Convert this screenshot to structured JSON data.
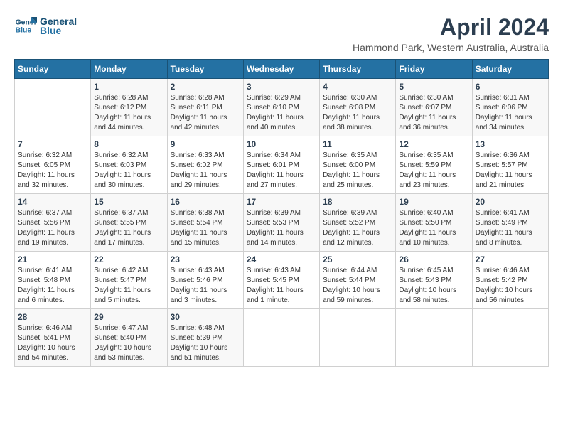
{
  "header": {
    "logo_line1": "General",
    "logo_line2": "Blue",
    "month_title": "April 2024",
    "subtitle": "Hammond Park, Western Australia, Australia"
  },
  "weekdays": [
    "Sunday",
    "Monday",
    "Tuesday",
    "Wednesday",
    "Thursday",
    "Friday",
    "Saturday"
  ],
  "weeks": [
    [
      {
        "day": "",
        "info": ""
      },
      {
        "day": "1",
        "info": "Sunrise: 6:28 AM\nSunset: 6:12 PM\nDaylight: 11 hours\nand 44 minutes."
      },
      {
        "day": "2",
        "info": "Sunrise: 6:28 AM\nSunset: 6:11 PM\nDaylight: 11 hours\nand 42 minutes."
      },
      {
        "day": "3",
        "info": "Sunrise: 6:29 AM\nSunset: 6:10 PM\nDaylight: 11 hours\nand 40 minutes."
      },
      {
        "day": "4",
        "info": "Sunrise: 6:30 AM\nSunset: 6:08 PM\nDaylight: 11 hours\nand 38 minutes."
      },
      {
        "day": "5",
        "info": "Sunrise: 6:30 AM\nSunset: 6:07 PM\nDaylight: 11 hours\nand 36 minutes."
      },
      {
        "day": "6",
        "info": "Sunrise: 6:31 AM\nSunset: 6:06 PM\nDaylight: 11 hours\nand 34 minutes."
      }
    ],
    [
      {
        "day": "7",
        "info": "Sunrise: 6:32 AM\nSunset: 6:05 PM\nDaylight: 11 hours\nand 32 minutes."
      },
      {
        "day": "8",
        "info": "Sunrise: 6:32 AM\nSunset: 6:03 PM\nDaylight: 11 hours\nand 30 minutes."
      },
      {
        "day": "9",
        "info": "Sunrise: 6:33 AM\nSunset: 6:02 PM\nDaylight: 11 hours\nand 29 minutes."
      },
      {
        "day": "10",
        "info": "Sunrise: 6:34 AM\nSunset: 6:01 PM\nDaylight: 11 hours\nand 27 minutes."
      },
      {
        "day": "11",
        "info": "Sunrise: 6:35 AM\nSunset: 6:00 PM\nDaylight: 11 hours\nand 25 minutes."
      },
      {
        "day": "12",
        "info": "Sunrise: 6:35 AM\nSunset: 5:59 PM\nDaylight: 11 hours\nand 23 minutes."
      },
      {
        "day": "13",
        "info": "Sunrise: 6:36 AM\nSunset: 5:57 PM\nDaylight: 11 hours\nand 21 minutes."
      }
    ],
    [
      {
        "day": "14",
        "info": "Sunrise: 6:37 AM\nSunset: 5:56 PM\nDaylight: 11 hours\nand 19 minutes."
      },
      {
        "day": "15",
        "info": "Sunrise: 6:37 AM\nSunset: 5:55 PM\nDaylight: 11 hours\nand 17 minutes."
      },
      {
        "day": "16",
        "info": "Sunrise: 6:38 AM\nSunset: 5:54 PM\nDaylight: 11 hours\nand 15 minutes."
      },
      {
        "day": "17",
        "info": "Sunrise: 6:39 AM\nSunset: 5:53 PM\nDaylight: 11 hours\nand 14 minutes."
      },
      {
        "day": "18",
        "info": "Sunrise: 6:39 AM\nSunset: 5:52 PM\nDaylight: 11 hours\nand 12 minutes."
      },
      {
        "day": "19",
        "info": "Sunrise: 6:40 AM\nSunset: 5:50 PM\nDaylight: 11 hours\nand 10 minutes."
      },
      {
        "day": "20",
        "info": "Sunrise: 6:41 AM\nSunset: 5:49 PM\nDaylight: 11 hours\nand 8 minutes."
      }
    ],
    [
      {
        "day": "21",
        "info": "Sunrise: 6:41 AM\nSunset: 5:48 PM\nDaylight: 11 hours\nand 6 minutes."
      },
      {
        "day": "22",
        "info": "Sunrise: 6:42 AM\nSunset: 5:47 PM\nDaylight: 11 hours\nand 5 minutes."
      },
      {
        "day": "23",
        "info": "Sunrise: 6:43 AM\nSunset: 5:46 PM\nDaylight: 11 hours\nand 3 minutes."
      },
      {
        "day": "24",
        "info": "Sunrise: 6:43 AM\nSunset: 5:45 PM\nDaylight: 11 hours\nand 1 minute."
      },
      {
        "day": "25",
        "info": "Sunrise: 6:44 AM\nSunset: 5:44 PM\nDaylight: 10 hours\nand 59 minutes."
      },
      {
        "day": "26",
        "info": "Sunrise: 6:45 AM\nSunset: 5:43 PM\nDaylight: 10 hours\nand 58 minutes."
      },
      {
        "day": "27",
        "info": "Sunrise: 6:46 AM\nSunset: 5:42 PM\nDaylight: 10 hours\nand 56 minutes."
      }
    ],
    [
      {
        "day": "28",
        "info": "Sunrise: 6:46 AM\nSunset: 5:41 PM\nDaylight: 10 hours\nand 54 minutes."
      },
      {
        "day": "29",
        "info": "Sunrise: 6:47 AM\nSunset: 5:40 PM\nDaylight: 10 hours\nand 53 minutes."
      },
      {
        "day": "30",
        "info": "Sunrise: 6:48 AM\nSunset: 5:39 PM\nDaylight: 10 hours\nand 51 minutes."
      },
      {
        "day": "",
        "info": ""
      },
      {
        "day": "",
        "info": ""
      },
      {
        "day": "",
        "info": ""
      },
      {
        "day": "",
        "info": ""
      }
    ]
  ]
}
